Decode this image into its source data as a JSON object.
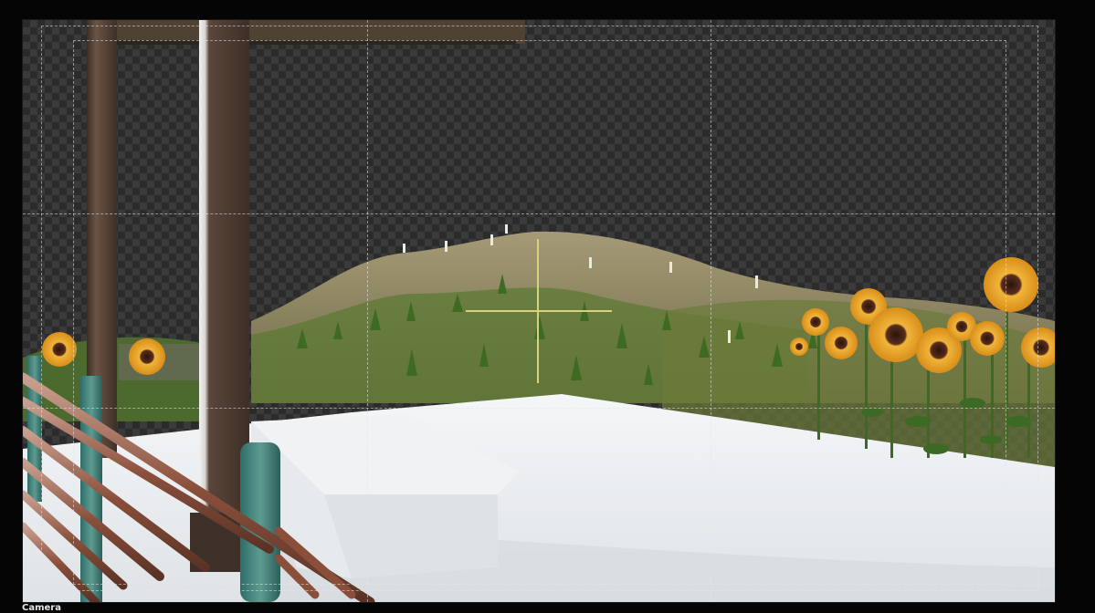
{
  "viewport": {
    "camera_label": "Camera"
  },
  "colors": {
    "background": "#050505",
    "transparency_dark": "#2b2b2b",
    "transparency_light": "#3a3a3a",
    "guide_lines": "#e6e6e6",
    "crosshair": "#d8d27a",
    "ground": "#e8ebee",
    "hill": "#8e8a64",
    "grass": "#4c7a2a",
    "sunflower_petal": "#e8a623",
    "sunflower_center": "#3a1f12",
    "wood": "#4a3a30",
    "rust_pipe": "#8a5a45",
    "teal_post": "#3f7f7a"
  },
  "icons": {
    "crosshair": "3d-cursor-icon"
  }
}
